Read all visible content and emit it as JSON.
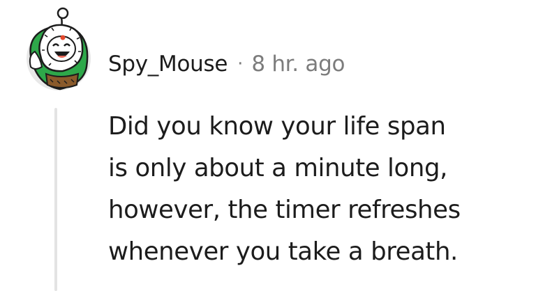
{
  "comment": {
    "author": "Spy_Mouse",
    "separator": "·",
    "timestamp": "8 hr. ago",
    "avatar_icon": "snoo-avatar-icon",
    "body_lines": [
      "Did you know your life span",
      "is only about a minute long,",
      "however, the timer refreshes",
      "whenever you take a breath."
    ]
  },
  "colors": {
    "text": "#1c1c1c",
    "meta": "#7c7c7c",
    "thread_line": "#e3e3e3",
    "avatar_bg": "#e8e8e8",
    "avatar_green": "#28a745"
  }
}
